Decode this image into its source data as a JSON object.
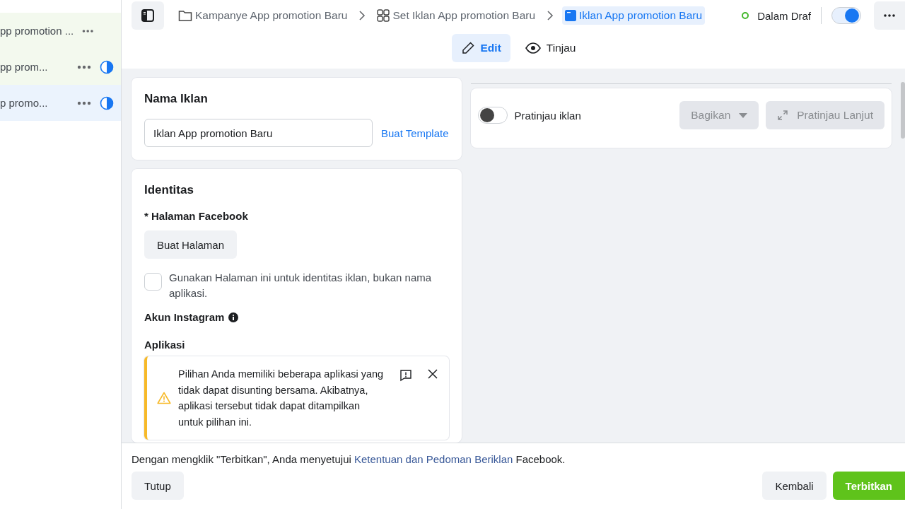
{
  "sidebar": {
    "items": [
      {
        "label": "pp promotion ...",
        "kind": "campaign",
        "selected": false
      },
      {
        "label": "pp prom...",
        "kind": "adset",
        "selected": false
      },
      {
        "label": "p promo...",
        "kind": "ad",
        "selected": true
      }
    ]
  },
  "breadcrumbs": [
    {
      "label": "Kampanye App promotion Baru",
      "kind": "campaign",
      "selected": false
    },
    {
      "label": "Set Iklan App promotion Baru",
      "kind": "adset",
      "selected": false
    },
    {
      "label": "Iklan App promotion Baru",
      "kind": "ad",
      "selected": true
    }
  ],
  "status": {
    "label": "Dalam Draf",
    "on": true
  },
  "tabs": [
    {
      "label": "Edit",
      "kind": "edit",
      "selected": true
    },
    {
      "label": "Tinjau",
      "kind": "view",
      "selected": false
    }
  ],
  "ad_name": {
    "title": "Nama Iklan",
    "value": "Iklan App promotion Baru",
    "link": "Buat Template"
  },
  "identity": {
    "title": "Identitas",
    "page_label": "* Halaman Facebook",
    "create_page_button": "Buat Halaman",
    "use_page_checkbox": {
      "label": "Gunakan Halaman ini untuk identitas iklan, bukan nama aplikasi.",
      "checked": false
    },
    "instagram_label": "Akun Instagram",
    "apps_label": "Aplikasi",
    "warning": "Pilihan Anda memiliki beberapa aplikasi yang tidak dapat disunting bersama. Akibatnya, aplikasi tersebut tidak dapat ditampilkan untuk pilihan ini."
  },
  "preview": {
    "label": "Pratinjau iklan",
    "on": false,
    "share_button": "Bagikan",
    "advanced_button": "Pratinjau Lanjut"
  },
  "footer": {
    "terms_before": "Dengan mengklik \"Terbitkan\", Anda menyetujui",
    "terms_link": "Ketentuan dan Pedoman Beriklan",
    "terms_after": "Facebook.",
    "close_button": "Tutup",
    "back_button": "Kembali",
    "publish_button": "Terbitkan"
  }
}
